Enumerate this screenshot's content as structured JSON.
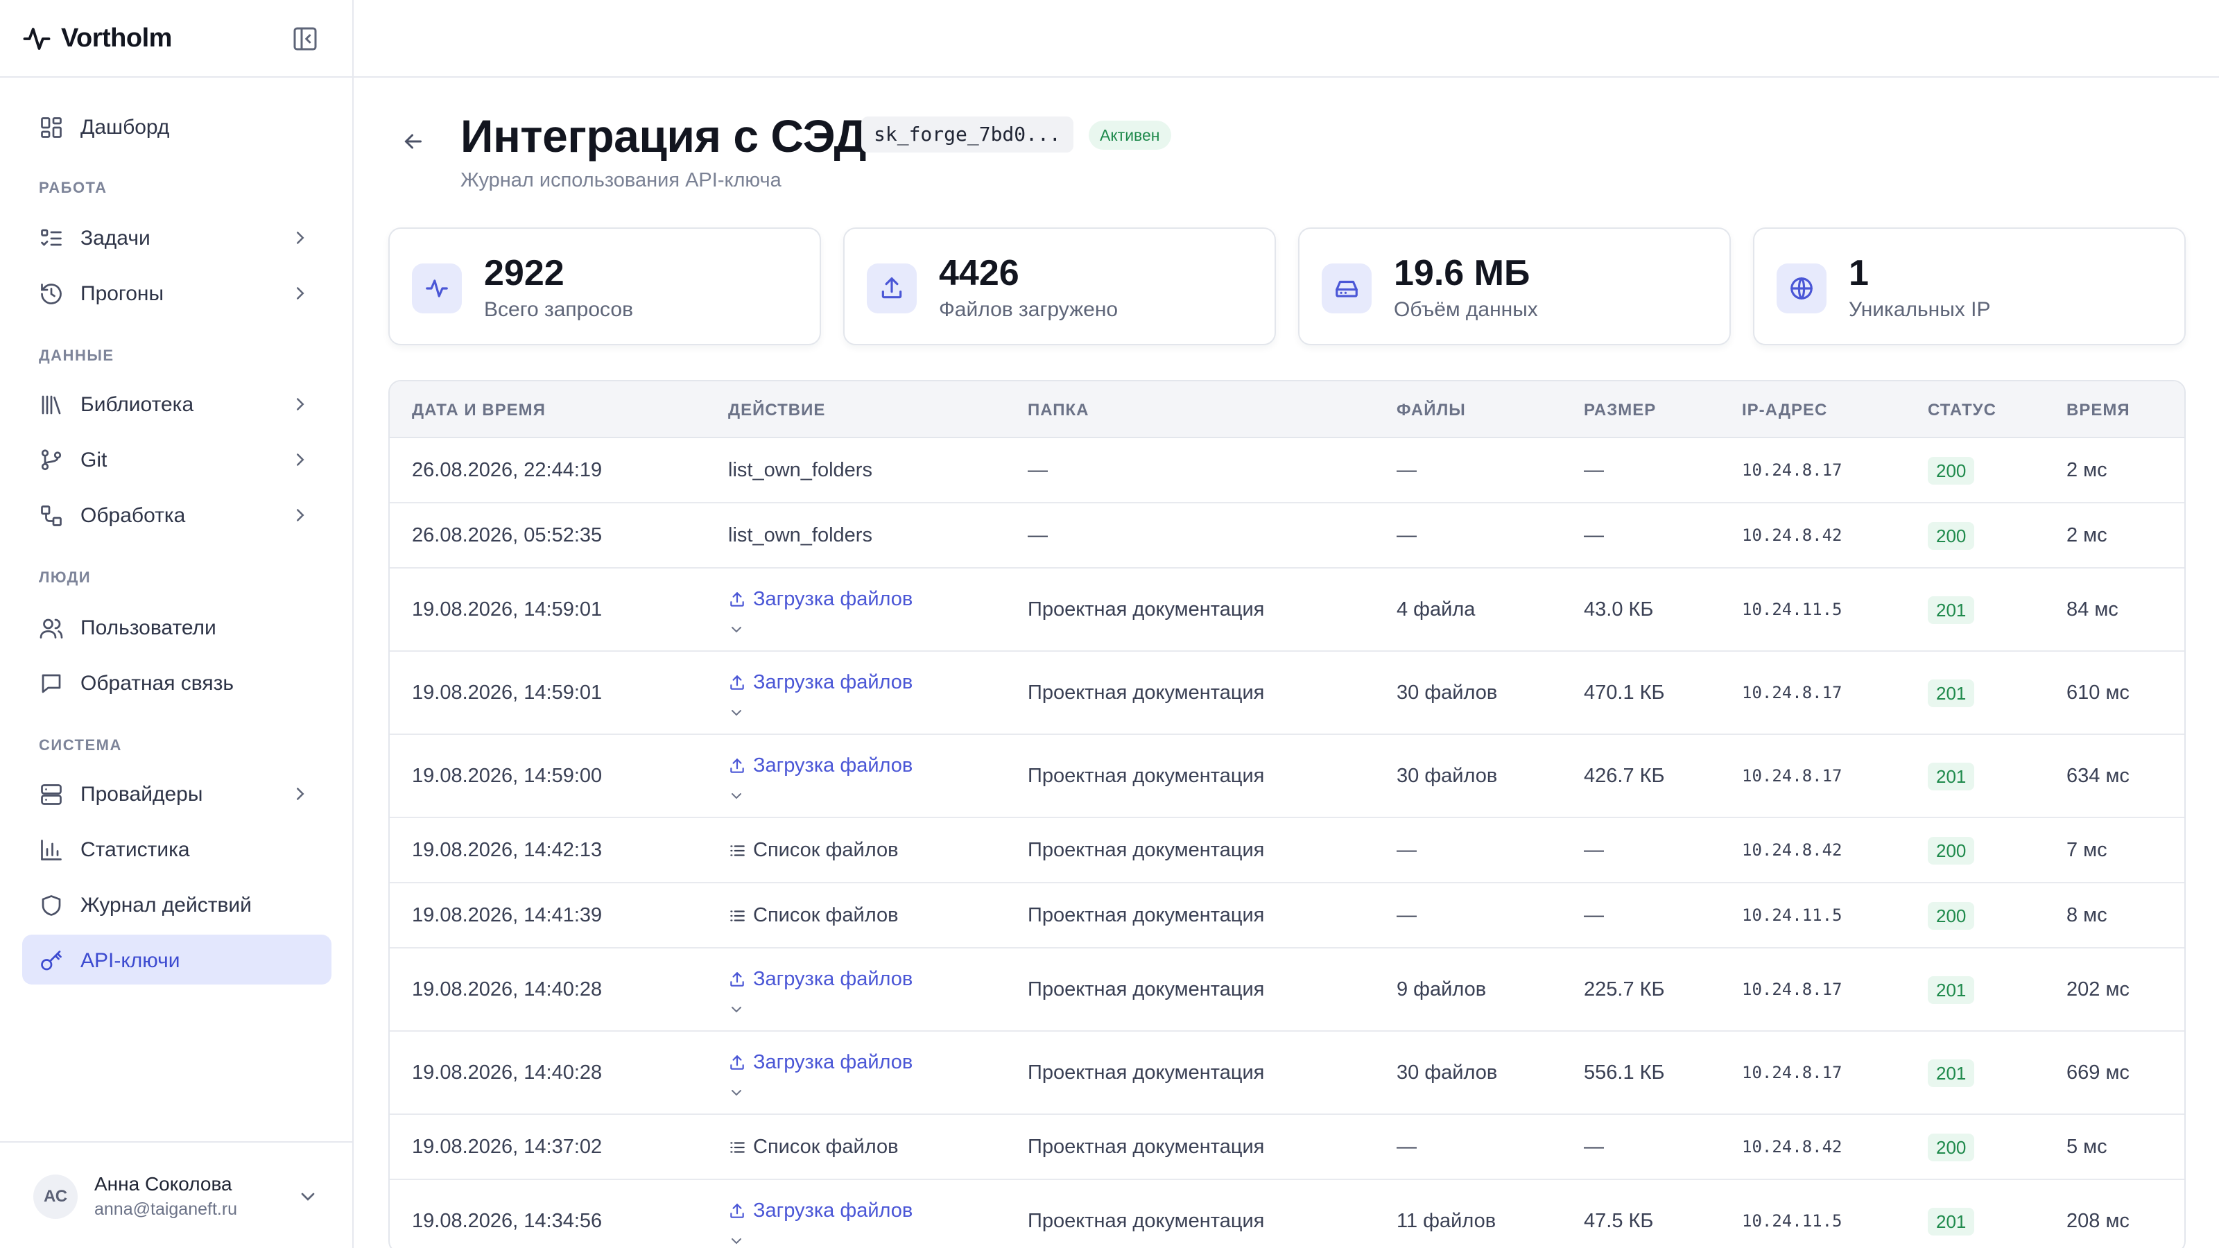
{
  "app": {
    "name": "Vortholm"
  },
  "sidebar": {
    "items": [
      {
        "label": "Дашборд"
      },
      {
        "label": "Задачи"
      },
      {
        "label": "Прогоны"
      },
      {
        "label": "Библиотека"
      },
      {
        "label": "Git"
      },
      {
        "label": "Обработка"
      },
      {
        "label": "Пользователи"
      },
      {
        "label": "Обратная связь"
      },
      {
        "label": "Провайдеры"
      },
      {
        "label": "Статистика"
      },
      {
        "label": "Журнал действий"
      },
      {
        "label": "API-ключи"
      }
    ],
    "sections": [
      "РАБОТА",
      "ДАННЫЕ",
      "ЛЮДИ",
      "СИСТЕМА"
    ]
  },
  "user": {
    "initials": "АС",
    "name": "Анна Соколова",
    "email": "anna@taiganeft.ru"
  },
  "page": {
    "title": "Интеграция с СЭД",
    "key": "sk_forge_7bd0...",
    "status": "Активен",
    "subtitle": "Журнал использования API-ключа"
  },
  "stats": [
    {
      "value": "2922",
      "label": "Всего запросов",
      "icon": "activity-icon"
    },
    {
      "value": "4426",
      "label": "Файлов загружено",
      "icon": "upload-icon"
    },
    {
      "value": "19.6 МБ",
      "label": "Объём данных",
      "icon": "hard-drive-icon"
    },
    {
      "value": "1",
      "label": "Уникальных IP",
      "icon": "globe-icon"
    }
  ],
  "table": {
    "headers": [
      "ДАТА И ВРЕМЯ",
      "ДЕЙСТВИЕ",
      "ПАПКА",
      "ФАЙЛЫ",
      "РАЗМЕР",
      "IP-АДРЕС",
      "СТАТУС",
      "ВРЕМЯ"
    ],
    "rows": [
      {
        "datetime": "26.08.2026, 22:44:19",
        "action": "list_own_folders",
        "kind": "plain",
        "folder": "—",
        "files": "—",
        "size": "—",
        "ip": "10.24.8.17",
        "status": "200",
        "time": "2 мс"
      },
      {
        "datetime": "26.08.2026, 05:52:35",
        "action": "list_own_folders",
        "kind": "plain",
        "folder": "—",
        "files": "—",
        "size": "—",
        "ip": "10.24.8.42",
        "status": "200",
        "time": "2 мс"
      },
      {
        "datetime": "19.08.2026, 14:59:01",
        "action": "Загрузка файлов",
        "kind": "upload",
        "folder": "Проектная документация",
        "files": "4 файла",
        "size": "43.0 КБ",
        "ip": "10.24.11.5",
        "status": "201",
        "time": "84 мс"
      },
      {
        "datetime": "19.08.2026, 14:59:01",
        "action": "Загрузка файлов",
        "kind": "upload",
        "folder": "Проектная документация",
        "files": "30 файлов",
        "size": "470.1 КБ",
        "ip": "10.24.8.17",
        "status": "201",
        "time": "610 мс"
      },
      {
        "datetime": "19.08.2026, 14:59:00",
        "action": "Загрузка файлов",
        "kind": "upload",
        "folder": "Проектная документация",
        "files": "30 файлов",
        "size": "426.7 КБ",
        "ip": "10.24.8.17",
        "status": "201",
        "time": "634 мс"
      },
      {
        "datetime": "19.08.2026, 14:42:13",
        "action": "Список файлов",
        "kind": "list",
        "folder": "Проектная документация",
        "files": "—",
        "size": "—",
        "ip": "10.24.8.42",
        "status": "200",
        "time": "7 мс"
      },
      {
        "datetime": "19.08.2026, 14:41:39",
        "action": "Список файлов",
        "kind": "list",
        "folder": "Проектная документация",
        "files": "—",
        "size": "—",
        "ip": "10.24.11.5",
        "status": "200",
        "time": "8 мс"
      },
      {
        "datetime": "19.08.2026, 14:40:28",
        "action": "Загрузка файлов",
        "kind": "upload",
        "folder": "Проектная документация",
        "files": "9 файлов",
        "size": "225.7 КБ",
        "ip": "10.24.8.17",
        "status": "201",
        "time": "202 мс"
      },
      {
        "datetime": "19.08.2026, 14:40:28",
        "action": "Загрузка файлов",
        "kind": "upload",
        "folder": "Проектная документация",
        "files": "30 файлов",
        "size": "556.1 КБ",
        "ip": "10.24.8.17",
        "status": "201",
        "time": "669 мс"
      },
      {
        "datetime": "19.08.2026, 14:37:02",
        "action": "Список файлов",
        "kind": "list",
        "folder": "Проектная документация",
        "files": "—",
        "size": "—",
        "ip": "10.24.8.42",
        "status": "200",
        "time": "5 мс"
      },
      {
        "datetime": "19.08.2026, 14:34:56",
        "action": "Загрузка файлов",
        "kind": "upload",
        "folder": "Проектная документация",
        "files": "11 файлов",
        "size": "47.5 КБ",
        "ip": "10.24.11.5",
        "status": "201",
        "time": "208 мс"
      }
    ]
  },
  "colors": {
    "accent": "#4a56d6",
    "active_bg": "#e3e7fd",
    "success": "#1f8a4c",
    "success_bg": "#e9f7ef"
  }
}
